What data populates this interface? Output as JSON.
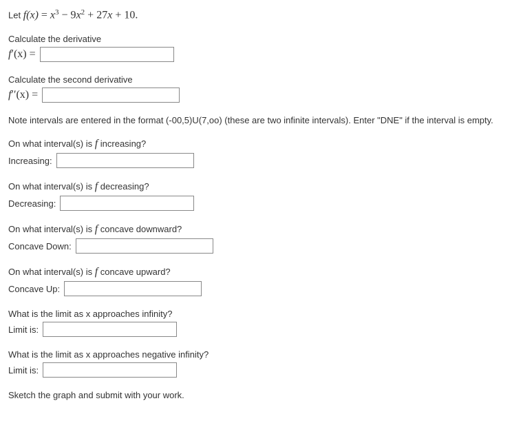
{
  "intro": {
    "let": "Let ",
    "fx": "f(x)",
    "eq": " = ",
    "expr_x3": "x",
    "expr_sup3": "3",
    "expr_minus": " − 9",
    "expr_x2": "x",
    "expr_sup2": "2",
    "expr_plus27": " + 27",
    "expr_x": "x",
    "expr_plus10": " + 10."
  },
  "deriv1": {
    "title": "Calculate the derivative",
    "label_f": "f",
    "label_prime": "′",
    "label_x": "(x) = "
  },
  "deriv2": {
    "title": "Calculate the second derivative",
    "label_f": "f",
    "label_prime": "′′",
    "label_x": "(x) = "
  },
  "note": "Note intervals are entered in the format (-00,5)U(7,oo) (these are two infinite intervals). Enter \"DNE\" if the interval is empty.",
  "increasing": {
    "q": "On what interval(s) is ",
    "f": "f",
    "q2": " increasing?",
    "label": "Increasing:"
  },
  "decreasing": {
    "q": "On what interval(s) is ",
    "f": "f",
    "q2": " decreasing?",
    "label": "Decreasing:"
  },
  "concave_down": {
    "q": "On what interval(s) is ",
    "f": "f",
    "q2": " concave downward?",
    "label": "Concave Down:"
  },
  "concave_up": {
    "q": "On what interval(s) is ",
    "f": "f",
    "q2": " concave upward?",
    "label": "Concave Up:"
  },
  "limit_pos": {
    "q": "What is the limit as x approaches infinity?",
    "label": "Limit is:"
  },
  "limit_neg": {
    "q": "What is the limit as x approaches negative infinity?",
    "label": "Limit is:"
  },
  "sketch": "Sketch the graph and submit with your work."
}
